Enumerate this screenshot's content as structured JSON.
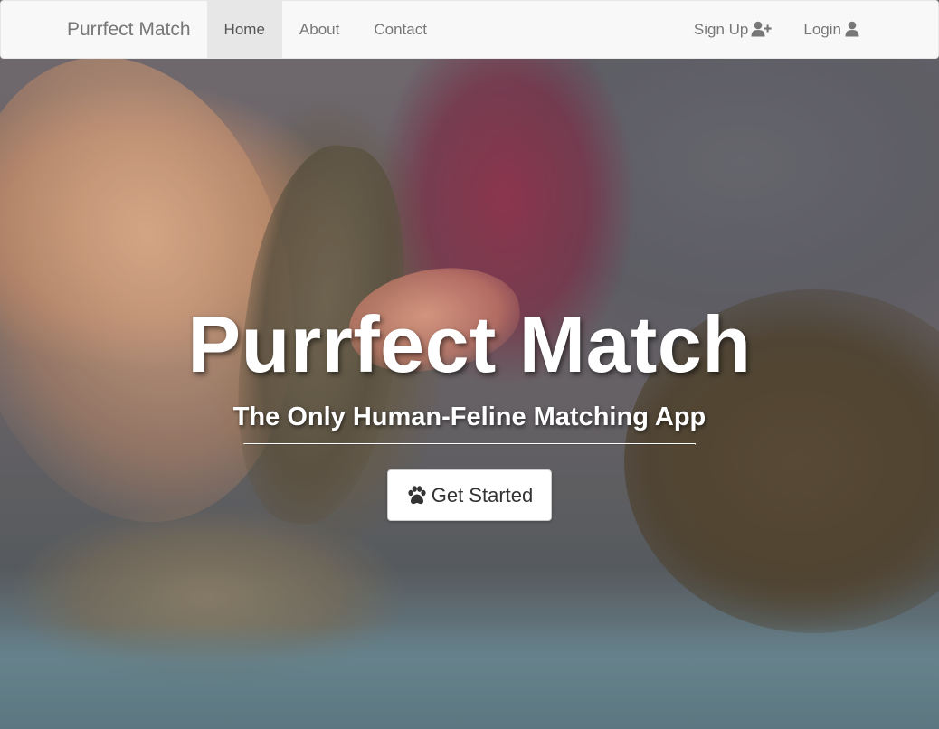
{
  "navbar": {
    "brand": "Purrfect Match",
    "links": [
      {
        "label": "Home",
        "active": true
      },
      {
        "label": "About",
        "active": false
      },
      {
        "label": "Contact",
        "active": false
      }
    ],
    "right": {
      "signup_label": "Sign Up",
      "signup_icon": "user-plus-icon",
      "login_label": "Login",
      "login_icon": "user-icon"
    }
  },
  "hero": {
    "title": "Purrfect Match",
    "subtitle": "The Only Human-Feline Matching App",
    "cta_label": "Get Started",
    "cta_icon": "paw-icon"
  },
  "colors": {
    "navbar_bg": "#f8f8f8",
    "nav_text": "#777777",
    "nav_active_bg": "#e7e7e7",
    "hero_text": "#ffffff",
    "button_bg": "#ffffff",
    "button_text": "#333333"
  }
}
